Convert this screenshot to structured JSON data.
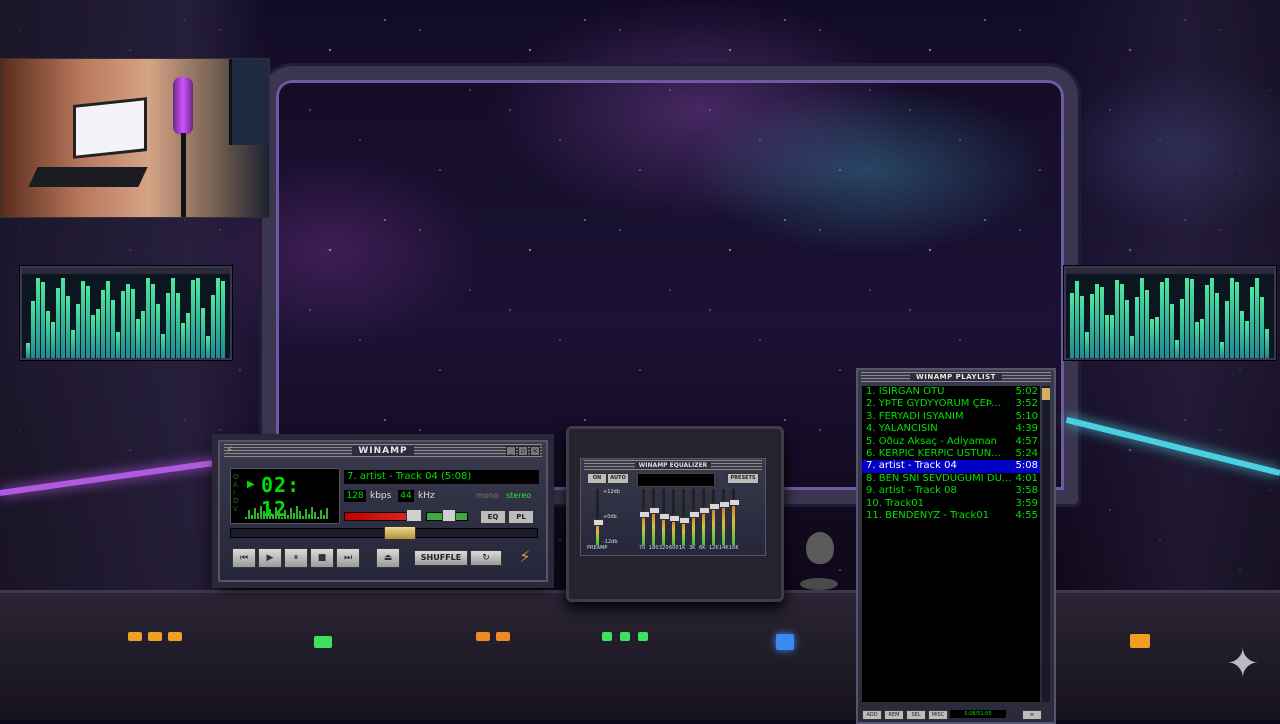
{
  "winamp": {
    "title": "WINAMP",
    "time": "02: 12",
    "status_chars": [
      "O",
      "A",
      "I",
      "D",
      "V"
    ],
    "song": "7. artist - Track 04 (5:08)",
    "kbps_value": "128",
    "kbps_label": "kbps",
    "khz_value": "44",
    "khz_label": "kHz",
    "mono": "mono",
    "stereo": "stereo",
    "eq_toggle": "EQ",
    "pl_toggle": "PL",
    "shuffle": "SHUFFLE",
    "volume_fraction": 0.8,
    "seek_fraction": 0.55
  },
  "equalizer": {
    "title": "WINAMP EQUALIZER",
    "on_button": "ON",
    "auto_button": "AUTO",
    "presets_button": "PRESETS",
    "db_labels": [
      "+12db",
      "+0db",
      "-12db"
    ],
    "preamp_label": "PREAMP",
    "bands": [
      "70",
      "180",
      "320",
      "600",
      "1K",
      "3K",
      "6K",
      "12K",
      "14K",
      "16K"
    ]
  },
  "playlist": {
    "title": "WINAMP PLAYLIST",
    "items": [
      {
        "title": "1. ISIRGAN OTU",
        "duration": "5:02"
      },
      {
        "title": "2. ŸÞTE GYDŸYORUM ÇEÞ...",
        "duration": "3:52"
      },
      {
        "title": "3. FERYADI İSYANIM",
        "duration": "5:10"
      },
      {
        "title": "4. YALANCISIN",
        "duration": "4:39"
      },
      {
        "title": "5. Oðuz Aksaç - Adiyaman",
        "duration": "4:57"
      },
      {
        "title": "6. KERPIC KERPIC USTUN...",
        "duration": "5:24"
      },
      {
        "title": "7. artist - Track 04",
        "duration": "5:08"
      },
      {
        "title": "8. BEN SNI SEVDUGUMI DU...",
        "duration": "4:01"
      },
      {
        "title": "9. artist - Track 08",
        "duration": "3:58"
      },
      {
        "title": "10. Track01",
        "duration": "3:59"
      },
      {
        "title": "11. BENDENYZ - Track01",
        "duration": "4:55"
      }
    ],
    "active_index": 6,
    "bottom_buttons": [
      "ADD",
      "REM",
      "SEL",
      "MISC"
    ],
    "info": "5:08/51:05"
  },
  "colors": {
    "lcd_green": "#00e000",
    "highlight": "#0000c6",
    "neon_purple": "#b05ae0",
    "neon_cyan": "#4ad0e0"
  }
}
